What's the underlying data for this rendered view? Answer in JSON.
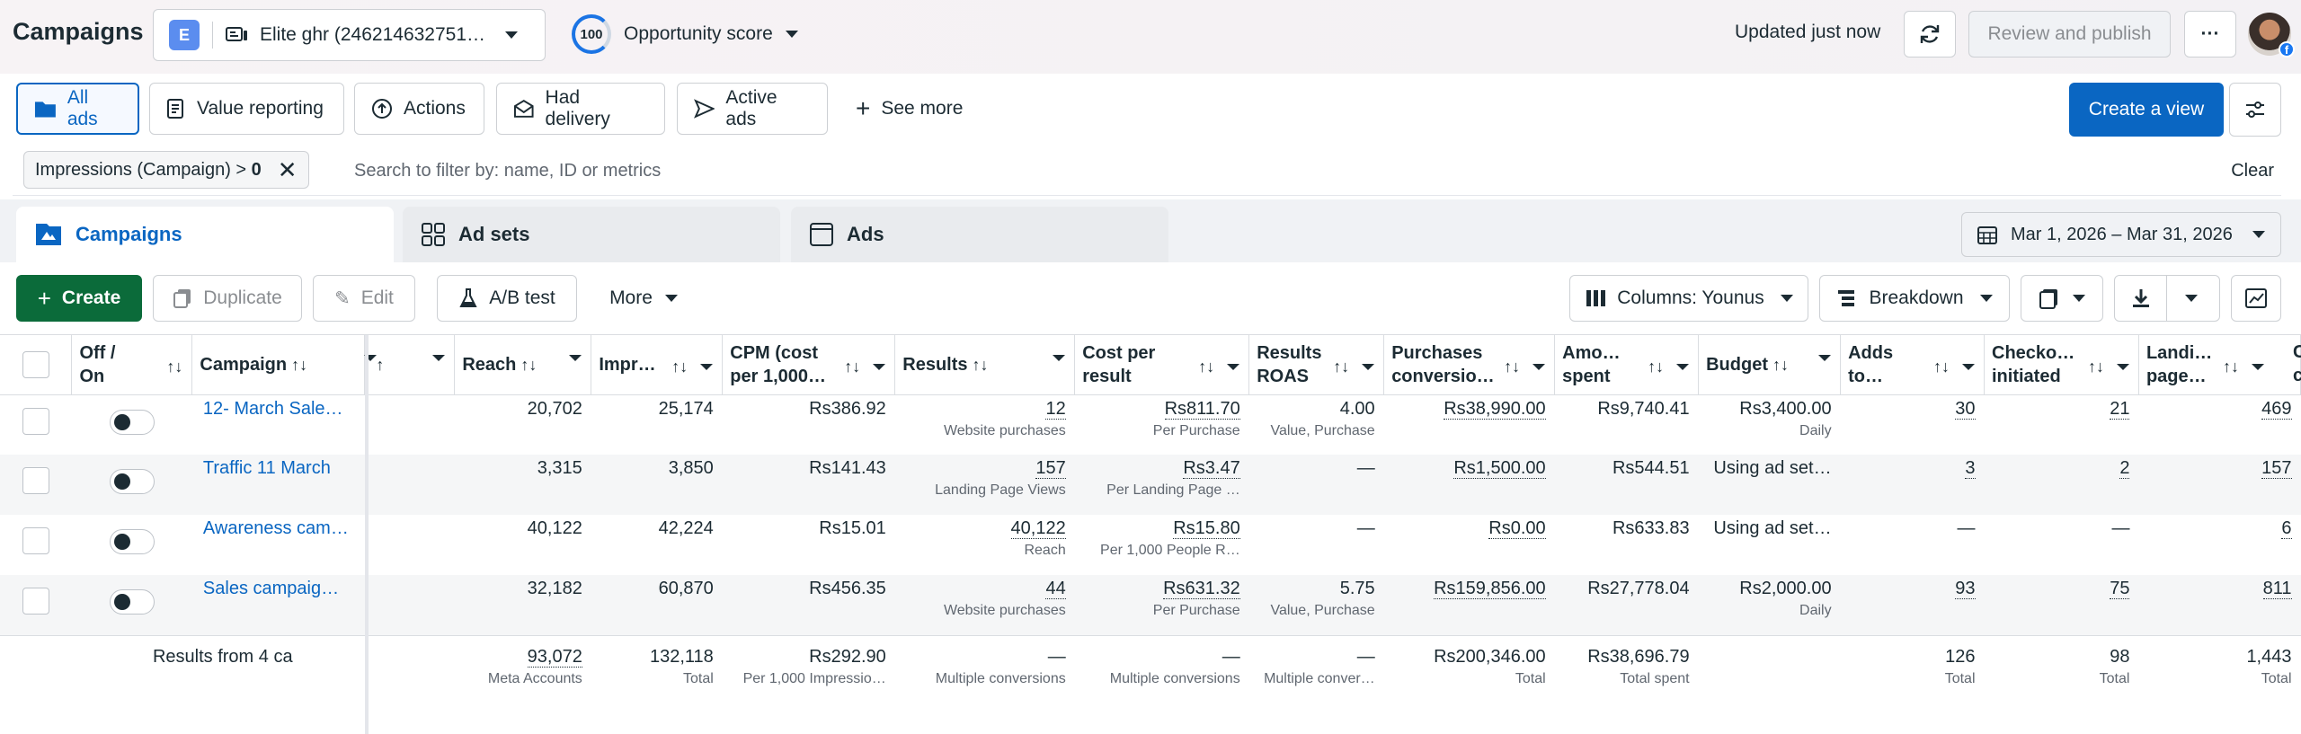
{
  "header": {
    "title": "Campaigns",
    "account_initial": "E",
    "account_name": "Elite ghr (246214632751…",
    "opportunity_score_value": "100",
    "opportunity_score_label": "Opportunity score",
    "updated": "Updated just now",
    "review_publish": "Review and publish",
    "more": "···"
  },
  "views": {
    "items": [
      "All ads",
      "Value reporting",
      "Actions",
      "Had delivery",
      "Active ads"
    ],
    "see_more": "See more",
    "create_view": "Create a view"
  },
  "filter": {
    "pill_label": "Impressions (Campaign) > ",
    "pill_value": "0",
    "search_placeholder": "Search to filter by: name, ID or metrics",
    "clear": "Clear"
  },
  "tabs": [
    "Campaigns",
    "Ad sets",
    "Ads"
  ],
  "date_range": "Mar 1, 2026 – Mar 31, 2026",
  "toolbar": {
    "create": "Create",
    "duplicate": "Duplicate",
    "edit": "Edit",
    "ab_test": "A/B test",
    "more": "More",
    "columns": "Columns: Younus",
    "breakdown": "Breakdown"
  },
  "columns": {
    "off_on": "Off / On",
    "campaign": "Campaign",
    "reach": "Reach",
    "impressions": "Impr…",
    "cpm": "CPM (cost per 1,000…",
    "results": "Results",
    "cost_per_result": "Cost per result",
    "results_roas": "Results ROAS",
    "purchases_conv": "Purchases conversio…",
    "amount_spent": "Amo… spent",
    "budget": "Budget",
    "adds_to": "Adds to…",
    "checkout": "Checko… initiated",
    "landing": "Landi… page…",
    "cut": "C c"
  },
  "rows": [
    {
      "campaign": "12- March Sales…",
      "reach": "20,702",
      "impr": "25,174",
      "cpm": "Rs386.92",
      "results": "12",
      "results_sub": "Website purchases",
      "cpr": "Rs811.70",
      "cpr_sub": "Per Purchase",
      "roas": "4.00",
      "roas_sub": "Value, Purchase",
      "purch": "Rs38,990.00",
      "spent": "Rs9,740.41",
      "budget": "Rs3,400.00",
      "budget_sub": "Daily",
      "adds": "30",
      "checkout": "21",
      "landing": "469"
    },
    {
      "campaign": "Traffic 11 March",
      "reach": "3,315",
      "impr": "3,850",
      "cpm": "Rs141.43",
      "results": "157",
      "results_sub": "Landing Page Views",
      "cpr": "Rs3.47",
      "cpr_sub": "Per Landing Page …",
      "roas": "—",
      "roas_sub": "",
      "purch": "Rs1,500.00",
      "spent": "Rs544.51",
      "budget": "Using ad set…",
      "budget_sub": "",
      "adds": "3",
      "checkout": "2",
      "landing": "157"
    },
    {
      "campaign": "Awareness cam…",
      "reach": "40,122",
      "impr": "42,224",
      "cpm": "Rs15.01",
      "results": "40,122",
      "results_sub": "Reach",
      "cpr": "Rs15.80",
      "cpr_sub": "Per 1,000 People R…",
      "roas": "—",
      "roas_sub": "",
      "purch": "Rs0.00",
      "spent": "Rs633.83",
      "budget": "Using ad set…",
      "budget_sub": "",
      "adds": "—",
      "checkout": "—",
      "landing": "6"
    },
    {
      "campaign": "Sales campaign…",
      "reach": "32,182",
      "impr": "60,870",
      "cpm": "Rs456.35",
      "results": "44",
      "results_sub": "Website purchases",
      "cpr": "Rs631.32",
      "cpr_sub": "Per Purchase",
      "roas": "5.75",
      "roas_sub": "Value, Purchase",
      "purch": "Rs159,856.00",
      "spent": "Rs27,778.04",
      "budget": "Rs2,000.00",
      "budget_sub": "Daily",
      "adds": "93",
      "checkout": "75",
      "landing": "811"
    }
  ],
  "totals": {
    "label": "Results from 4 ca",
    "reach": "93,072",
    "reach_sub": "Meta Accounts",
    "impr": "132,118",
    "impr_sub": "Total",
    "cpm": "Rs292.90",
    "cpm_sub": "Per 1,000 Impressio…",
    "results": "—",
    "results_sub": "Multiple conversions",
    "cpr": "—",
    "cpr_sub": "Multiple conversions",
    "roas": "—",
    "roas_sub": "Multiple conver…",
    "purch": "Rs200,346.00",
    "purch_sub": "Total",
    "spent": "Rs38,696.79",
    "spent_sub": "Total spent",
    "adds": "126",
    "adds_sub": "Total",
    "checkout": "98",
    "checkout_sub": "Total",
    "landing": "1,443",
    "landing_sub": "Total"
  },
  "colors": {
    "accent": "#0a66c2",
    "create_green": "#0b6b3a"
  }
}
